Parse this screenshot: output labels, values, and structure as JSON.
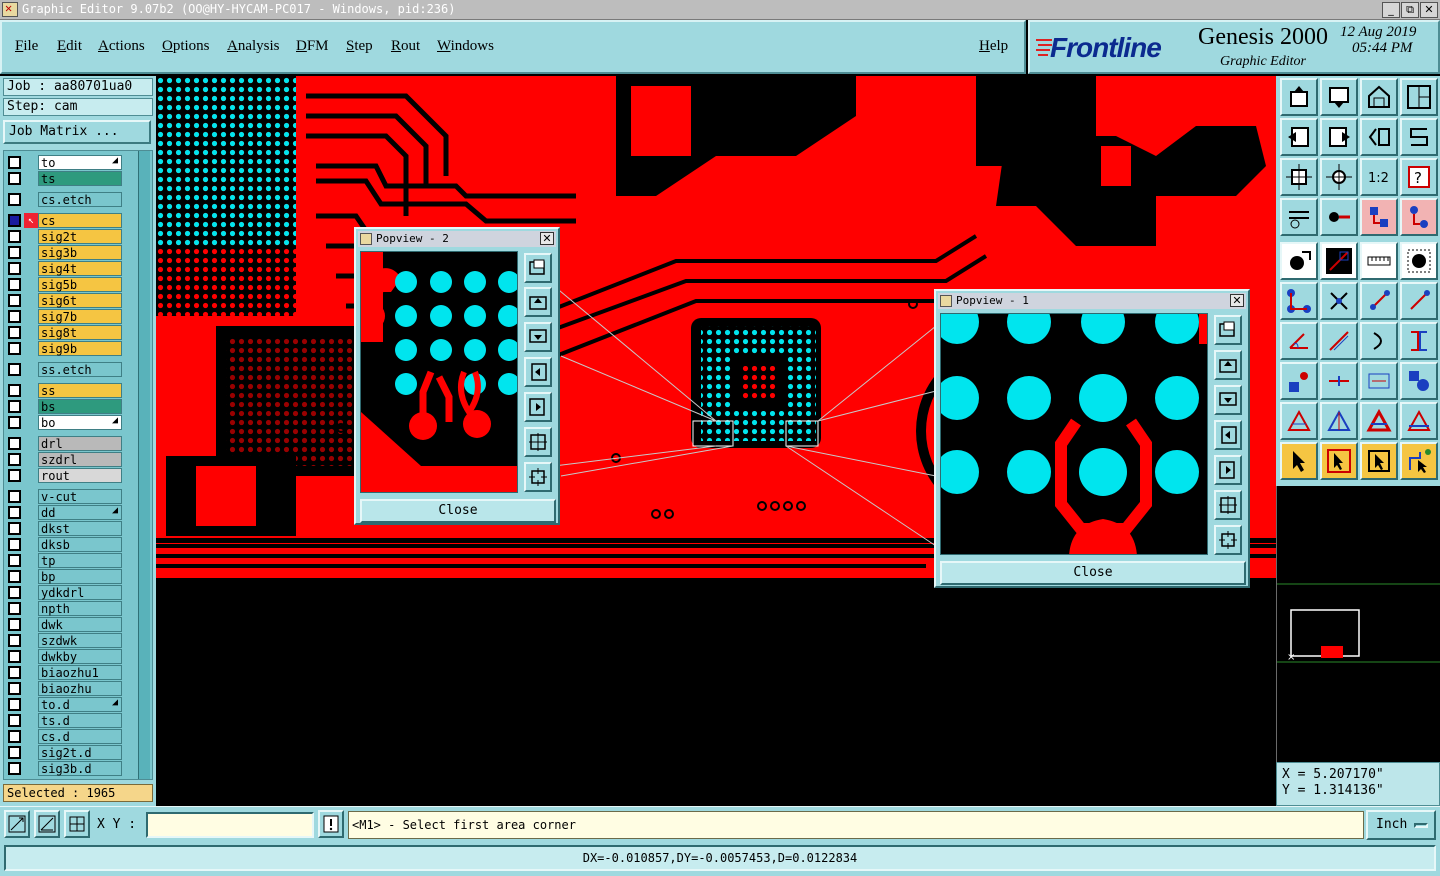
{
  "window": {
    "title": "Graphic Editor 9.07b2 (OO@HY-HYCAM-PC017 - Windows, pid:236)",
    "buttons": [
      "_",
      "⧉",
      "✕"
    ]
  },
  "menu": {
    "items": [
      "File",
      "Edit",
      "Actions",
      "Options",
      "Analysis",
      "DFM",
      "Step",
      "Rout",
      "Windows"
    ],
    "help": "Help"
  },
  "brand": {
    "logo": "Frontline",
    "product": "Genesis 2000",
    "subtitle": "Graphic Editor",
    "date": "12 Aug 2019",
    "time": "05:44 PM"
  },
  "left": {
    "job": "Job : aa80701ua0",
    "step": "Step: cam",
    "job_matrix": "Job Matrix ...",
    "selected": "Selected : 1965"
  },
  "layers": [
    {
      "name": "to",
      "color": "#ffffff",
      "arrow": true,
      "gap": false
    },
    {
      "name": "ts",
      "color": "#2e9a7e",
      "arrow": false,
      "gap": false
    },
    {
      "name": "cs.etch",
      "color": "#7ac6cd",
      "arrow": false,
      "gap": true
    },
    {
      "name": "cs",
      "color": "#f5c542",
      "arrow": false,
      "gap": true,
      "active": true
    },
    {
      "name": "sig2t",
      "color": "#f5c542"
    },
    {
      "name": "sig3b",
      "color": "#f5c542"
    },
    {
      "name": "sig4t",
      "color": "#f5c542"
    },
    {
      "name": "sig5b",
      "color": "#f5c542"
    },
    {
      "name": "sig6t",
      "color": "#f5c542"
    },
    {
      "name": "sig7b",
      "color": "#f5c542"
    },
    {
      "name": "sig8t",
      "color": "#f5c542"
    },
    {
      "name": "sig9b",
      "color": "#f5c542"
    },
    {
      "name": "ss.etch",
      "color": "#7ac6cd",
      "gap": true
    },
    {
      "name": "ss",
      "color": "#f5c542",
      "gap": true
    },
    {
      "name": "bs",
      "color": "#2e9a7e"
    },
    {
      "name": "bo",
      "color": "#ffffff",
      "arrow": true
    },
    {
      "name": "drl",
      "color": "#b9b9b9",
      "gap": true
    },
    {
      "name": "szdrl",
      "color": "#b9b9b9"
    },
    {
      "name": "rout",
      "color": "#d8d8d8"
    },
    {
      "name": "v-cut",
      "color": "#7ac6cd",
      "gap": true
    },
    {
      "name": "dd",
      "color": "#7ac6cd",
      "arrow": true
    },
    {
      "name": "dkst",
      "color": "#7ac6cd"
    },
    {
      "name": "dksb",
      "color": "#7ac6cd"
    },
    {
      "name": "tp",
      "color": "#7ac6cd"
    },
    {
      "name": "bp",
      "color": "#7ac6cd"
    },
    {
      "name": "ydkdrl",
      "color": "#7ac6cd"
    },
    {
      "name": "npth",
      "color": "#7ac6cd"
    },
    {
      "name": "dwk",
      "color": "#7ac6cd"
    },
    {
      "name": "szdwk",
      "color": "#7ac6cd"
    },
    {
      "name": "dwkby",
      "color": "#7ac6cd"
    },
    {
      "name": "biaozhu1",
      "color": "#7ac6cd"
    },
    {
      "name": "biaozhu",
      "color": "#7ac6cd"
    },
    {
      "name": "to.d",
      "color": "#7ac6cd",
      "arrow": true
    },
    {
      "name": "ts.d",
      "color": "#7ac6cd"
    },
    {
      "name": "cs.d",
      "color": "#7ac6cd"
    },
    {
      "name": "sig2t.d",
      "color": "#7ac6cd"
    },
    {
      "name": "sig3b.d",
      "color": "#7ac6cd"
    }
  ],
  "popview2": {
    "title": "Popview - 2",
    "close": "Close"
  },
  "popview1": {
    "title": "Popview - 1",
    "close": "Close"
  },
  "coords": {
    "x": "X = 5.207170\"",
    "y": "Y = 1.314136\""
  },
  "bottom": {
    "xy_label": "X Y :",
    "xy_value": "",
    "prompt": "<M1> - Select first area corner",
    "units": "Inch",
    "measure": "DX=-0.010857,DY=-0.0057453,D=0.0122834"
  },
  "colors": {
    "panel": "#9fd9df",
    "copper": "#ff0000",
    "pads": "#00e5ee"
  }
}
